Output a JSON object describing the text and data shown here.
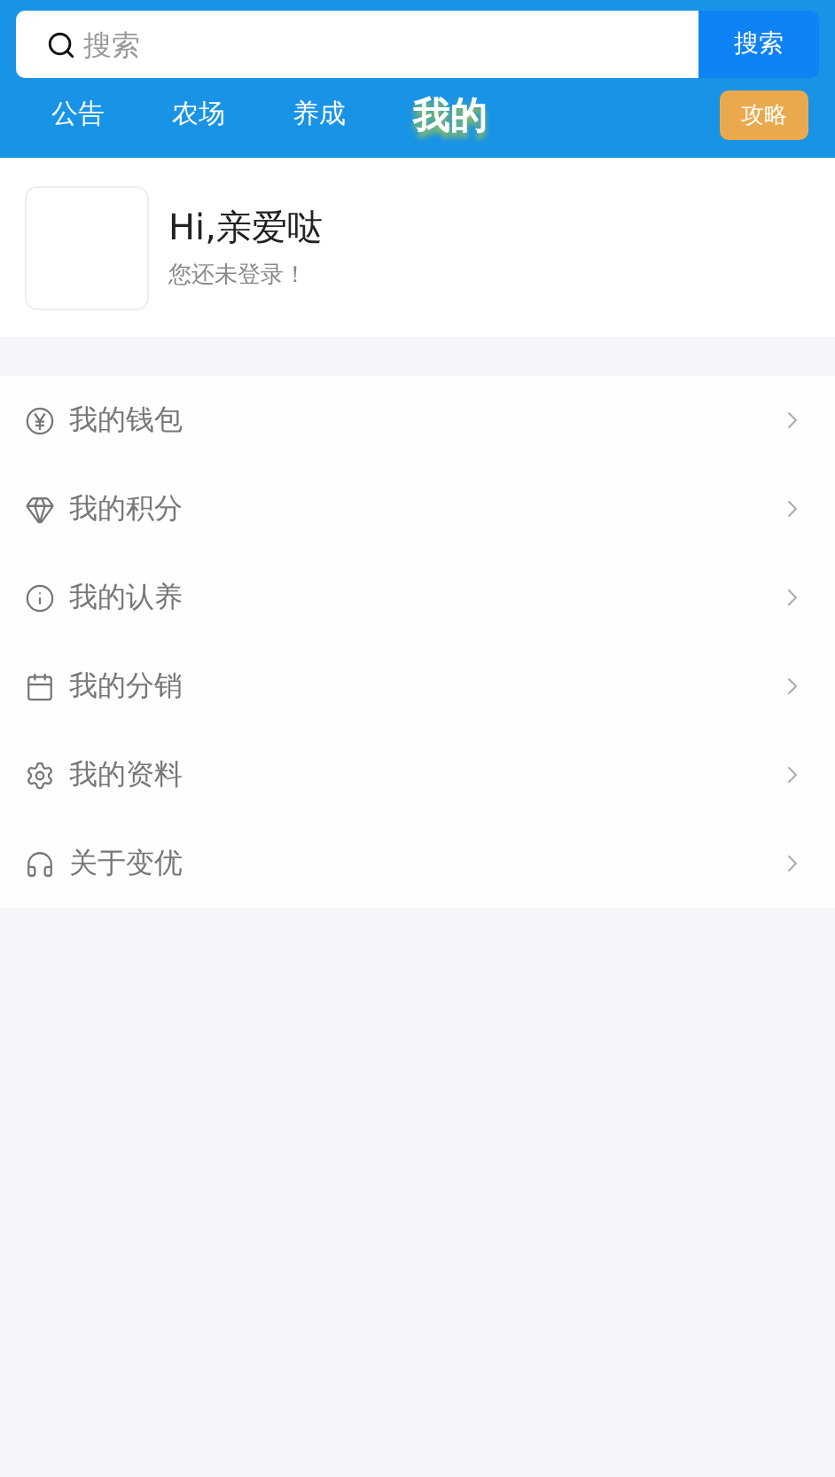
{
  "search": {
    "placeholder": "搜索",
    "button": "搜索"
  },
  "tabs": [
    {
      "label": "公告",
      "selected": false
    },
    {
      "label": "农场",
      "selected": false
    },
    {
      "label": "养成",
      "selected": false
    },
    {
      "label": "我的",
      "selected": true
    }
  ],
  "guide_button": "攻略",
  "profile": {
    "greeting": "Hi,亲爱哒",
    "status": "您还未登录！"
  },
  "menu": [
    {
      "label": "我的钱包"
    },
    {
      "label": "我的积分"
    },
    {
      "label": "我的认养"
    },
    {
      "label": "我的分销"
    },
    {
      "label": "我的资料"
    },
    {
      "label": "关于变优"
    }
  ]
}
